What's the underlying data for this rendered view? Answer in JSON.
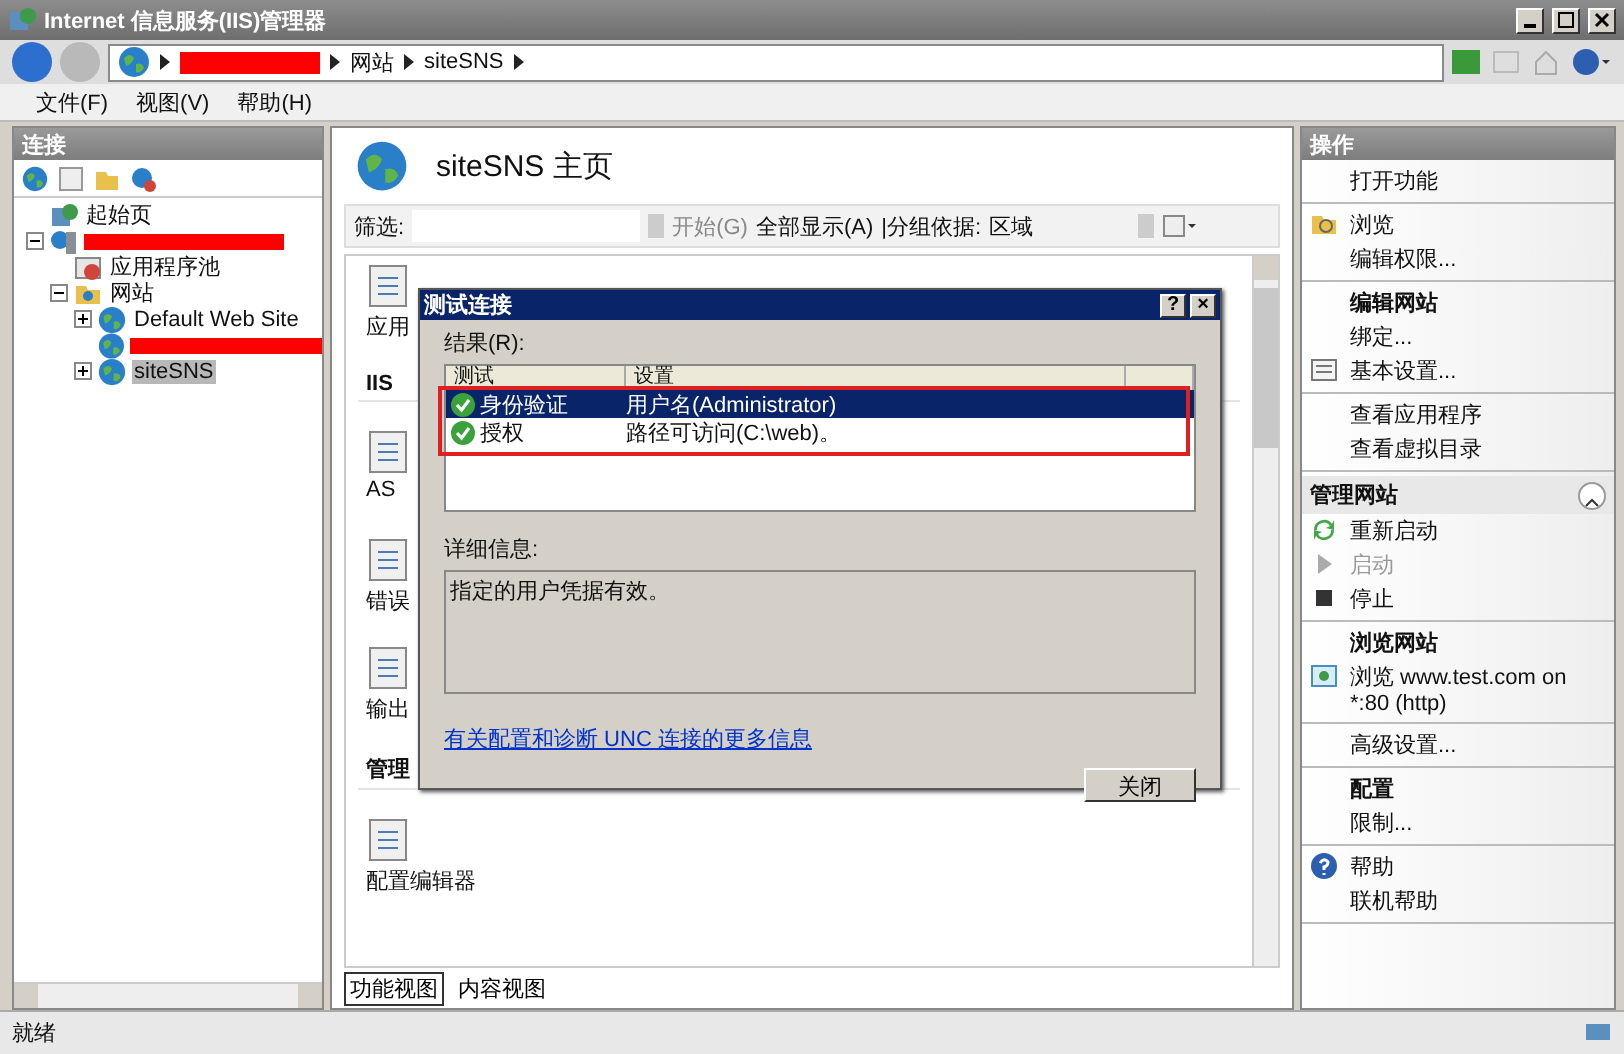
{
  "window": {
    "title": "Internet 信息服务(IIS)管理器"
  },
  "address": {
    "crumbs": [
      {
        "kind": "redacted"
      },
      {
        "kind": "text",
        "label": "网站"
      },
      {
        "kind": "text",
        "label": "siteSNS"
      }
    ]
  },
  "menu": [
    "文件(F)",
    "视图(V)",
    "帮助(H)"
  ],
  "connections": {
    "title": "连接",
    "tree": [
      {
        "kind": "text",
        "label": "起始页",
        "selected": false
      },
      {
        "kind": "redacted",
        "expanded": true,
        "children": [
          {
            "kind": "text",
            "label": "应用程序池",
            "selected": false
          },
          {
            "kind": "text",
            "label": "网站",
            "selected": false,
            "expanded": true,
            "children": [
              {
                "kind": "text",
                "label": "Default Web Site",
                "selected": false,
                "expanded": false
              },
              {
                "kind": "redacted"
              },
              {
                "kind": "text",
                "label": "siteSNS",
                "selected": true,
                "expanded": false
              }
            ]
          }
        ]
      }
    ]
  },
  "page": {
    "title": "siteSNS 主页",
    "filter": {
      "label": "筛选:",
      "go": "开始(G)",
      "show_all": "全部显示(A)",
      "group_label": "|分组依据:",
      "group_value": "区域"
    },
    "features": [
      {
        "kind": "item",
        "label": "应用"
      },
      {
        "kind": "heading",
        "label": "IIS"
      },
      {
        "kind": "item",
        "label": "AS"
      },
      {
        "kind": "item",
        "label": "错误"
      },
      {
        "kind": "item",
        "label": "输出"
      },
      {
        "kind": "heading",
        "label": "管理"
      },
      {
        "kind": "item",
        "label": "配置编辑器"
      }
    ],
    "views": [
      {
        "label": "功能视图",
        "selected": true
      },
      {
        "label": "内容视图",
        "selected": false
      }
    ]
  },
  "dialog": {
    "title": "测试连接",
    "help": "?",
    "close": "×",
    "results_label": "结果(R):",
    "columns": [
      "测试",
      "设置"
    ],
    "rows": [
      {
        "test": "身份验证",
        "setting": "用户名(Administrator)",
        "selected": true
      },
      {
        "test": "授权",
        "setting": "路径可访问(C:\\web)。",
        "selected": false
      }
    ],
    "details_label": "详细信息:",
    "details": "指定的用户凭据有效。",
    "link": "有关配置和诊断 UNC 连接的更多信息",
    "button": "关闭"
  },
  "actions": {
    "title": "操作",
    "groups": [
      {
        "items": [
          {
            "kind": "link",
            "label": "打开功能"
          }
        ]
      },
      {
        "items": [
          {
            "kind": "link",
            "label": "浏览"
          },
          {
            "kind": "link",
            "label": "编辑权限..."
          }
        ]
      },
      {
        "items": [
          {
            "kind": "heading",
            "label": "编辑网站"
          },
          {
            "kind": "link",
            "label": "绑定..."
          },
          {
            "kind": "link",
            "label": "基本设置..."
          }
        ]
      },
      {
        "items": [
          {
            "kind": "link",
            "label": "查看应用程序"
          },
          {
            "kind": "link",
            "label": "查看虚拟目录"
          }
        ]
      },
      {
        "kind": "section",
        "label": "管理网站",
        "expanded": true,
        "items": [
          {
            "kind": "link",
            "label": "重新启动"
          },
          {
            "kind": "link",
            "label": "启动",
            "disabled": true
          },
          {
            "kind": "link",
            "label": "停止"
          }
        ]
      },
      {
        "items": [
          {
            "kind": "heading",
            "label": "浏览网站"
          },
          {
            "kind": "link",
            "label": "浏览 www.test.com on *:80 (http)"
          }
        ]
      },
      {
        "items": [
          {
            "kind": "link",
            "label": "高级设置..."
          }
        ]
      },
      {
        "items": [
          {
            "kind": "heading",
            "label": "配置"
          },
          {
            "kind": "link",
            "label": "限制..."
          }
        ]
      },
      {
        "items": [
          {
            "kind": "link",
            "label": "帮助"
          },
          {
            "kind": "link",
            "label": "联机帮助"
          }
        ]
      }
    ]
  },
  "status_bar": {
    "text": "就绪"
  }
}
